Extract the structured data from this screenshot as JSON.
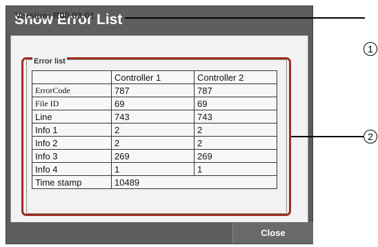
{
  "dialog": {
    "title": "Show Error List",
    "version_label": "Version: R00.03.01",
    "group_title": "Error list",
    "close_label": "Close"
  },
  "table": {
    "headers": [
      "",
      "Controller 1",
      "Controller 2"
    ],
    "rows": [
      {
        "label": "ErrorCode",
        "c1": "787",
        "c2": "787"
      },
      {
        "label": "File ID",
        "c1": "69",
        "c2": "69"
      },
      {
        "label": "Line",
        "c1": "743",
        "c2": "743"
      },
      {
        "label": "Info 1",
        "c1": "2",
        "c2": "2"
      },
      {
        "label": "Info 2",
        "c1": "2",
        "c2": "2"
      },
      {
        "label": "Info 3",
        "c1": "269",
        "c2": "269"
      },
      {
        "label": "Info 4",
        "c1": "1",
        "c2": "1"
      }
    ],
    "timestamp": {
      "label": "Time stamp",
      "value": "10489"
    }
  },
  "callouts": [
    "1",
    "2"
  ],
  "colors": {
    "highlight_frame": "#9c2c1d",
    "chrome": "#5e5e5e"
  }
}
